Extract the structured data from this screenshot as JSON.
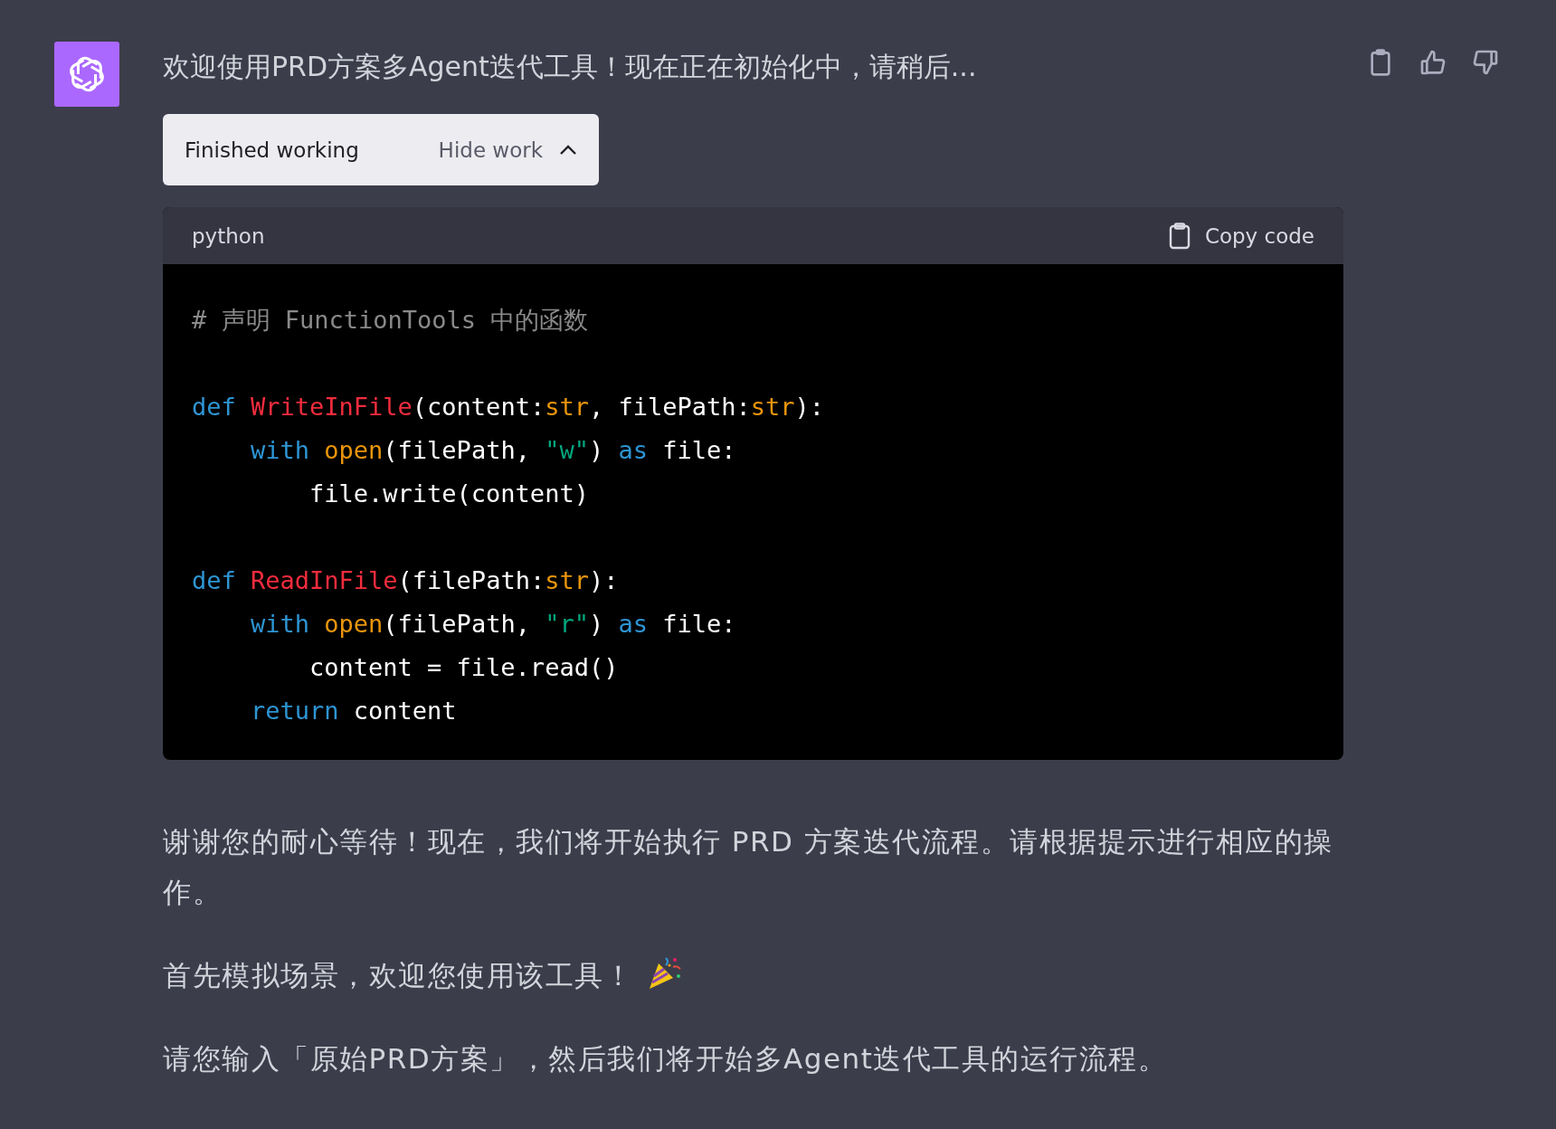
{
  "message": {
    "title": "欢迎使用PRD方案多Agent迭代工具！现在正在初始化中，请稍后...",
    "work_panel": {
      "status": "Finished working",
      "toggle": "Hide work",
      "expanded": true
    },
    "code_block": {
      "language": "python",
      "copy_label": "Copy code",
      "groups": [
        [
          [
            {
              "kind": "comment",
              "text": "# 声明 FunctionTools 中的函数"
            }
          ]
        ],
        [
          [
            {
              "kind": "keyword",
              "text": "def "
            },
            {
              "kind": "function",
              "text": "WriteInFile"
            },
            {
              "kind": "plain",
              "text": "(content:"
            },
            {
              "kind": "builtin",
              "text": "str"
            },
            {
              "kind": "plain",
              "text": ", filePath:"
            },
            {
              "kind": "builtin",
              "text": "str"
            },
            {
              "kind": "plain",
              "text": "):"
            }
          ],
          [
            {
              "kind": "keyword",
              "text": "    with "
            },
            {
              "kind": "builtin",
              "text": "open"
            },
            {
              "kind": "plain",
              "text": "(filePath, "
            },
            {
              "kind": "string",
              "text": "\"w\""
            },
            {
              "kind": "plain",
              "text": ") "
            },
            {
              "kind": "keyword",
              "text": "as"
            },
            {
              "kind": "plain",
              "text": " file:"
            }
          ],
          [
            {
              "kind": "plain",
              "text": "        file.write(content)"
            }
          ]
        ],
        [
          [
            {
              "kind": "keyword",
              "text": "def "
            },
            {
              "kind": "function",
              "text": "ReadInFile"
            },
            {
              "kind": "plain",
              "text": "(filePath:"
            },
            {
              "kind": "builtin",
              "text": "str"
            },
            {
              "kind": "plain",
              "text": "):"
            }
          ],
          [
            {
              "kind": "keyword",
              "text": "    with "
            },
            {
              "kind": "builtin",
              "text": "open"
            },
            {
              "kind": "plain",
              "text": "(filePath, "
            },
            {
              "kind": "string",
              "text": "\"r\""
            },
            {
              "kind": "plain",
              "text": ") "
            },
            {
              "kind": "keyword",
              "text": "as"
            },
            {
              "kind": "plain",
              "text": " file:"
            }
          ],
          [
            {
              "kind": "plain",
              "text": "        content = file.read()"
            }
          ],
          [
            {
              "kind": "keyword",
              "text": "    return"
            },
            {
              "kind": "plain",
              "text": " content"
            }
          ]
        ]
      ]
    },
    "paragraphs": [
      {
        "text": "谢谢您的耐心等待！现在，我们将开始执行 PRD 方案迭代流程。请根据提示进行相应的操作。",
        "party_icon": false
      },
      {
        "text": "首先模拟场景，欢迎您使用该工具！",
        "party_icon": true
      },
      {
        "text": "请您输入「原始PRD方案」，然后我们将开始多Agent迭代工具的运行流程。",
        "party_icon": false
      }
    ]
  }
}
